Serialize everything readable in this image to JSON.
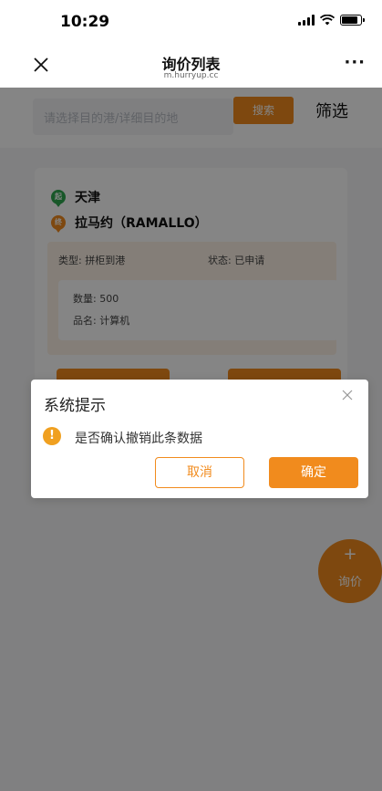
{
  "status_bar": {
    "time": "10:29"
  },
  "nav": {
    "title": "询价列表",
    "subtitle": "m.hurryup.cc",
    "more": "···"
  },
  "search": {
    "placeholder": "请选择目的港/详细目的地",
    "button_label": "搜索",
    "filter_label": "筛选"
  },
  "card": {
    "origin_badge": "起",
    "origin": "天津",
    "destination_badge": "终",
    "destination": "拉马约（RAMALLO）",
    "type_text": "类型: 拼柜到港",
    "status_text": "状态: 已申请",
    "quantity_text": "数量: 500",
    "product_text": "品名: 计算机"
  },
  "fab": {
    "plus": "+",
    "label": "询价"
  },
  "dialog": {
    "title": "系统提示",
    "warning_symbol": "!",
    "message": "是否确认撤销此条数据",
    "cancel_label": "取消",
    "confirm_label": "确定"
  },
  "colors": {
    "accent": "#f18b1d",
    "origin_marker": "#2fa84f",
    "warning": "#f0a020",
    "overlay": "rgba(0,0,0,0.48)"
  }
}
